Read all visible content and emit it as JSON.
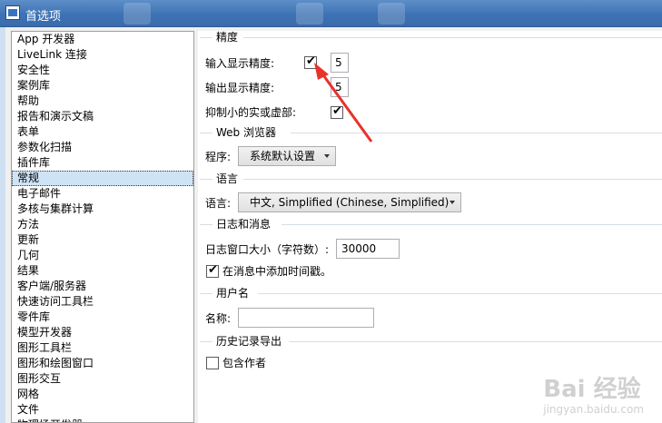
{
  "window": {
    "title": "首选项"
  },
  "nav": {
    "items": [
      "App 开发器",
      "LiveLink 连接",
      "安全性",
      "案例库",
      "帮助",
      "报告和演示文稿",
      "表单",
      "参数化扫描",
      "插件库",
      "常规",
      "电子邮件",
      "多核与集群计算",
      "方法",
      "更新",
      "几何",
      "结果",
      "客户端/服务器",
      "快速访问工具栏",
      "零件库",
      "模型开发器",
      "图形工具栏",
      "图形和绘图窗口",
      "图形交互",
      "网格",
      "文件",
      "物理场开发器"
    ],
    "selected_index": 9
  },
  "precision": {
    "header": "精度",
    "input_label": "输入显示精度:",
    "input_value": "5",
    "output_label": "输出显示精度:",
    "output_value": "5",
    "suppress_label": "抑制小的实或虚部:"
  },
  "web": {
    "header": "Web 浏览器",
    "program_label": "程序:",
    "program_value": "系统默认设置"
  },
  "language": {
    "header": "语言",
    "label": "语言:",
    "value": "中文, Simplified (Chinese, Simplified)"
  },
  "log": {
    "header": "日志和消息",
    "size_label": "日志窗口大小（字符数）:",
    "size_value": "30000",
    "timestamp_label": "在消息中添加时间戳。"
  },
  "user": {
    "header": "用户名",
    "name_label": "名称:",
    "name_value": ""
  },
  "history": {
    "header": "历史记录导出",
    "author_label": "包含作者"
  },
  "watermark": {
    "main": "Bai 经验",
    "sub": "jingyan.baidu.com"
  },
  "colors": {
    "titlebar": "#3d72b4",
    "selection": "#cfe3f7",
    "annotation": "#e8322c"
  }
}
